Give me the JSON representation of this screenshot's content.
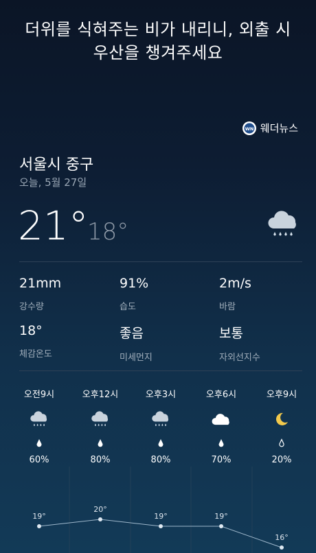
{
  "headline": {
    "line1": "더위를 식혀주는 비가 내리니, 외출 시",
    "line2": "우산을 챙겨주세요"
  },
  "brand": {
    "name": "웨더뉴스",
    "logo_text": "WN"
  },
  "location": "서울시 중구",
  "date": "오늘, 5월 27일",
  "current": {
    "temp": "21°",
    "low": "18°",
    "icon": "cloud-rain-icon"
  },
  "stats": [
    {
      "value": "21mm",
      "label": "강수량"
    },
    {
      "value": "91%",
      "label": "습도"
    },
    {
      "value": "2m/s",
      "label": "바람"
    },
    {
      "value": "18°",
      "label": "체감온도"
    },
    {
      "value": "좋음",
      "label": "미세먼지"
    },
    {
      "value": "보통",
      "label": "자외선지수"
    }
  ],
  "hourly": [
    {
      "time": "오전9시",
      "icon": "cloud-rain-icon",
      "pop": "60%",
      "temp": "19°",
      "temp_value": 19
    },
    {
      "time": "오후12시",
      "icon": "cloud-rain-icon",
      "pop": "80%",
      "temp": "20°",
      "temp_value": 20
    },
    {
      "time": "오후3시",
      "icon": "cloud-rain-icon",
      "pop": "80%",
      "temp": "19°",
      "temp_value": 19
    },
    {
      "time": "오후6시",
      "icon": "cloud-icon",
      "pop": "70%",
      "temp": "19°",
      "temp_value": 19
    },
    {
      "time": "오후9시",
      "icon": "moon-icon",
      "pop": "20%",
      "temp": "16°",
      "temp_value": 16
    }
  ],
  "colors": {
    "background_top": "#0b1526",
    "background_bottom": "#123a57",
    "moon": "#f2c94c",
    "muted_text": "#9aa7b5"
  }
}
